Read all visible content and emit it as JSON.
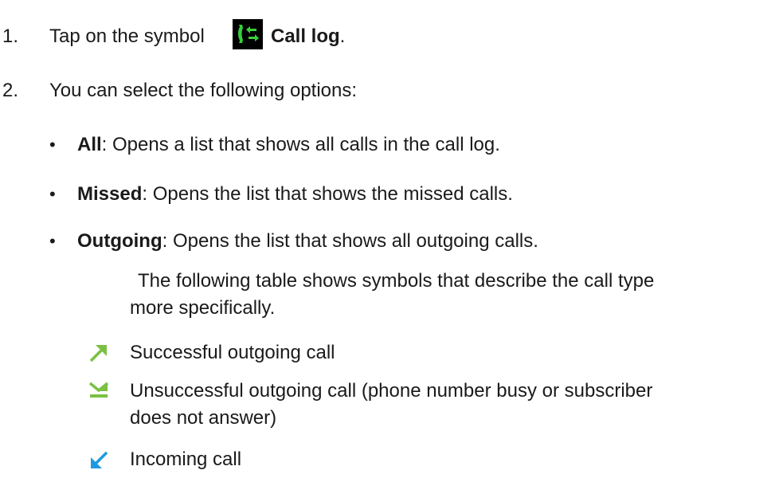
{
  "steps": [
    {
      "number": "1.",
      "text_before": "Tap on the symbol",
      "icon": "call-log-icon",
      "bold": "Call log",
      "text_after": "."
    },
    {
      "number": "2.",
      "text": "You can select the following options:"
    }
  ],
  "options": [
    {
      "label": "All",
      "description": ": Opens a list that shows all calls in the call log."
    },
    {
      "label": "Missed",
      "description": ": Opens the list that shows the missed calls."
    },
    {
      "label": "Outgoing",
      "description": ": Opens the list that shows all outgoing calls."
    }
  ],
  "note": {
    "line1": "The following table shows symbols that describe the call type",
    "line2": "more specifically."
  },
  "call_types": [
    {
      "icon": "successful-outgoing-arrow-icon",
      "color": "#7bc043",
      "text": "Successful outgoing call"
    },
    {
      "icon": "unsuccessful-outgoing-icon",
      "color": "#7bc043",
      "text_line1": "Unsuccessful outgoing call (phone number busy or subscriber",
      "text_line2": "does not answer)"
    },
    {
      "icon": "incoming-arrow-icon",
      "color": "#1e9be0",
      "text": "Incoming call"
    }
  ],
  "colors": {
    "text": "#1a1a1a",
    "icon_bg": "#000000",
    "icon_green": "#35d13a"
  }
}
